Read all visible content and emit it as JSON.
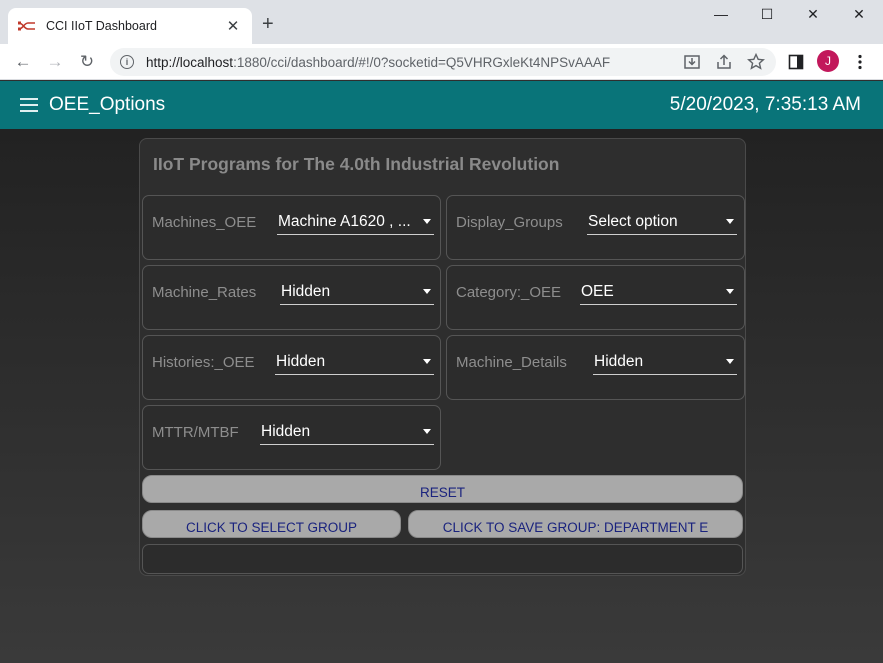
{
  "browser": {
    "tab_title": "CCI IIoT Dashboard",
    "tab_close": "✕",
    "new_tab": "+",
    "window": {
      "minimize": "—",
      "maximize": "☐",
      "close": "✕"
    },
    "nav": {
      "back": "←",
      "forward": "→",
      "reload": "↻"
    },
    "url_host": "http://localhost",
    "url_rest": ":1880/cci/dashboard/#!/0?socketid=Q5VHRGxleKt4NPSvAAAF",
    "profile_initial": "J"
  },
  "header": {
    "title": "OEE_Options",
    "datetime": "5/20/2023, 7:35:13 AM"
  },
  "card": {
    "title": "IIoT Programs for The 4.0th Industrial Revolution",
    "widgets": [
      {
        "label": "Machines_OEE",
        "value": "Machine A1620 , ..."
      },
      {
        "label": "Display_Groups",
        "value": "Select option"
      },
      {
        "label": "Machine_Rates",
        "value": "Hidden"
      },
      {
        "label": "Category:_OEE",
        "value": "OEE"
      },
      {
        "label": "Histories:_OEE",
        "value": "Hidden"
      },
      {
        "label": "Machine_Details",
        "value": "Hidden"
      },
      {
        "label": "MTTR/MTBF",
        "value": "Hidden"
      }
    ],
    "buttons": {
      "reset": "RESET",
      "select_group": "CLICK TO SELECT GROUP",
      "save_group": "CLICK TO SAVE GROUP: DEPARTMENT E"
    }
  },
  "colors": {
    "header_bg": "#097479",
    "button_bg": "#a9a9a9",
    "button_text": "#1a237e"
  }
}
